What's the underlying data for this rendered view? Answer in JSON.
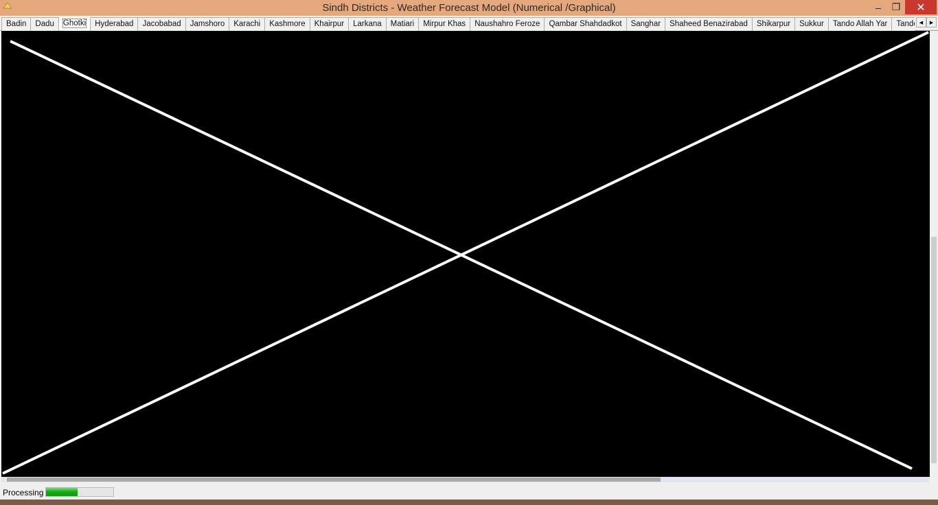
{
  "window": {
    "title": "Sindh Districts - Weather Forecast Model  (Numerical /Graphical)",
    "minimize_glyph": "–",
    "restore_glyph": "❐",
    "close_glyph": "✕"
  },
  "tabs": [
    {
      "label": "Badin"
    },
    {
      "label": "Dadu"
    },
    {
      "label": "Ghotki",
      "selected": true
    },
    {
      "label": "Hyderabad"
    },
    {
      "label": "Jacobabad"
    },
    {
      "label": "Jamshoro"
    },
    {
      "label": "Karachi"
    },
    {
      "label": "Kashmore"
    },
    {
      "label": "Khairpur"
    },
    {
      "label": "Larkana"
    },
    {
      "label": "Matiari"
    },
    {
      "label": "Mirpur Khas"
    },
    {
      "label": "Naushahro Feroze"
    },
    {
      "label": "Qambar Shahdadkot"
    },
    {
      "label": "Sanghar"
    },
    {
      "label": "Shaheed Benazirabad"
    },
    {
      "label": "Shikarpur"
    },
    {
      "label": "Sukkur"
    },
    {
      "label": "Tando Allah Yar"
    },
    {
      "label": "Tando Muhammad Khan"
    }
  ],
  "tab_scroll": {
    "left_glyph": "◀",
    "right_glyph": "▶"
  },
  "status": {
    "label": "Processing",
    "progress": 0.47
  },
  "colors": {
    "titlebar": "#e4a87c",
    "close_button": "#c7382f",
    "panel_background": "#000000",
    "error_cross": "#ffffff",
    "progress_fill": "#13a813"
  }
}
